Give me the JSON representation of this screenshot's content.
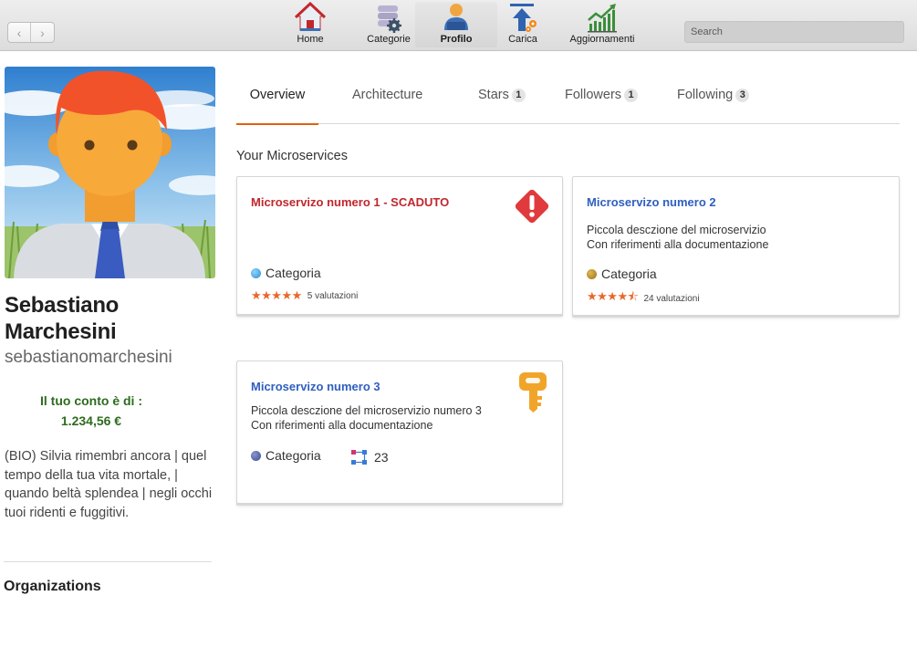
{
  "toolbar": {
    "back_label": "‹",
    "forward_label": "›",
    "items": [
      {
        "label": "Home",
        "icon": "home-icon"
      },
      {
        "label": "Categorie",
        "icon": "categories-gear-icon"
      },
      {
        "label": "Profilo",
        "icon": "profile-icon",
        "active": true
      },
      {
        "label": "Carica",
        "icon": "upload-icon"
      },
      {
        "label": "Aggiornamenti",
        "icon": "updates-chart-icon"
      }
    ],
    "search_placeholder": "Search"
  },
  "profile": {
    "name": "Sebastiano Marchesini",
    "username": "sebastianomarchesini",
    "balance_label": "Il tuo conto è di :",
    "balance_value": "1.234,56 €",
    "bio": "(BIO) Silvia rimembri ancora | quel tempo della tua vita mortale, | quando beltà splendea | negli occhi tuoi ridenti e fuggitivi.",
    "organizations_title": "Organizations"
  },
  "tabs": [
    {
      "label": "Overview",
      "active": true
    },
    {
      "label": "Architecture"
    },
    {
      "label": "Stars",
      "count": "1"
    },
    {
      "label": "Followers",
      "count": "1"
    },
    {
      "label": "Following",
      "count": "3"
    }
  ],
  "section_title": "Your Microservices",
  "cards": [
    {
      "title": "Microservizo numero 1 - SCADUTO",
      "status": "expired",
      "icon": "warning-diamond-icon",
      "category": "Categoria",
      "category_color": "#3a9fd8",
      "stars": "★★★★★",
      "ratings": "5 valutazioni"
    },
    {
      "title": "Microservizo numero 2",
      "desc_line1": "Piccola desczione del microservizio",
      "desc_line2": "Con riferimenti alla documentazione",
      "category": "Categoria",
      "category_color": "#b98a2a",
      "stars": "★★★★⯪",
      "ratings": "24  valutazioni"
    },
    {
      "title": "Microservizo numero 3",
      "icon": "key-icon",
      "desc_line1": "Piccola desczione del microservizio numero 3",
      "desc_line2": "Con riferimenti alla documentazione",
      "category": "Categoria",
      "category_color": "#4c5a9a",
      "nodes_icon": "architecture-nodes-icon",
      "nodes_count": "23"
    }
  ],
  "colors": {
    "accent_tab": "#e36209",
    "expired_title": "#c0272d",
    "normal_title": "#2f5fbf",
    "balance": "#2e6b1e",
    "stars": "#e8682c"
  }
}
